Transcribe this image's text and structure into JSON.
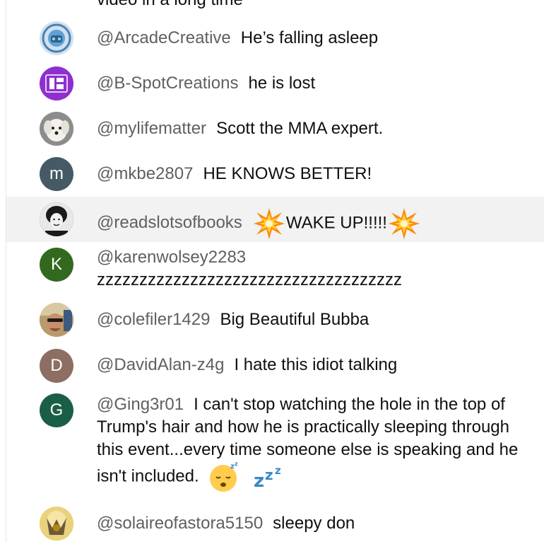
{
  "chat": {
    "partial_text": "video in a long time",
    "messages": [
      {
        "author": "@ArcadeCreative",
        "text": "He’s falling asleep",
        "avatar": {
          "kind": "image",
          "icon": "arcade-logo",
          "color": "#4a7fb5"
        }
      },
      {
        "author": "@B-SpotCreations",
        "text": "he is lost",
        "avatar": {
          "kind": "image",
          "icon": "bspot-logo",
          "color": "#8e2fd0"
        }
      },
      {
        "author": "@mylifematter",
        "text": "Scott the MMA expert.",
        "avatar": {
          "kind": "image",
          "icon": "dog-photo",
          "color": "#9a9a9a"
        }
      },
      {
        "author": "@mkbe2807",
        "text": "HE KNOWS BETTER!",
        "avatar": {
          "kind": "letter",
          "letter": "m",
          "color": "#455a64"
        }
      },
      {
        "author": "@readslotsofbooks",
        "text": "WAKE UP!!!!!",
        "avatar": {
          "kind": "image",
          "icon": "portrait-photo",
          "color": "#2b2b2b"
        },
        "emoji": [
          "collision",
          "collision"
        ]
      },
      {
        "author": "@karenwolsey2283",
        "text": "zzzzzzzzzzzzzzzzzzzzzzzzzzzzzzzzzzzz",
        "avatar": {
          "kind": "letter",
          "letter": "K",
          "color": "#33691e"
        }
      },
      {
        "author": "@colefiler1429",
        "text": "Big Beautiful Bubba",
        "avatar": {
          "kind": "image",
          "icon": "selfie-photo",
          "color": "#7a6a4f"
        }
      },
      {
        "author": "@DavidAlan-z4g",
        "text": "I hate this idiot talking",
        "avatar": {
          "kind": "letter",
          "letter": "D",
          "color": "#8d6e63"
        }
      },
      {
        "author": "@Ging3r01",
        "text": "I can't stop watching the hole in the top of Trump's hair and how he is practically sleeping through this event...every time someone else is speaking and he isn't included.",
        "avatar": {
          "kind": "letter",
          "letter": "G",
          "color": "#1b5e46"
        },
        "emoji": [
          "sleeping-face",
          "zzz"
        ]
      },
      {
        "author": "@solaireofastora5150",
        "text": "sleepy don",
        "avatar": {
          "kind": "image",
          "icon": "solaire-photo",
          "color": "#c9a227"
        }
      }
    ]
  }
}
